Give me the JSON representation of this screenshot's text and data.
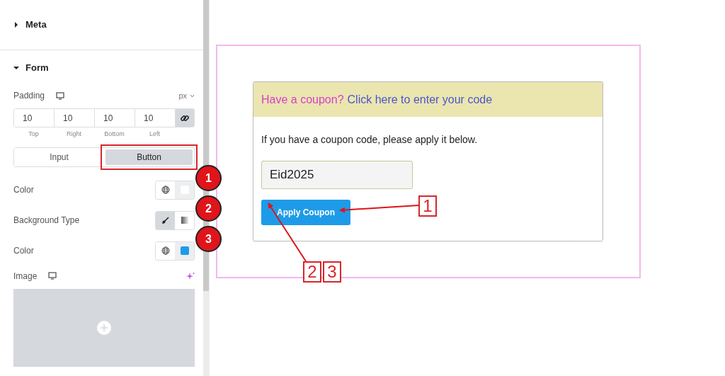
{
  "sidebar": {
    "sections": [
      {
        "title": "Meta",
        "expanded": false
      },
      {
        "title": "Form",
        "expanded": true
      }
    ],
    "padding": {
      "label": "Padding",
      "unit": "px",
      "linked": true,
      "fields": [
        {
          "value": "10",
          "label": "Top"
        },
        {
          "value": "10",
          "label": "Right"
        },
        {
          "value": "10",
          "label": "Bottom"
        },
        {
          "value": "10",
          "label": "Left"
        }
      ]
    },
    "tabs": [
      {
        "label": "Input",
        "selected": false,
        "highlighted": false
      },
      {
        "label": "Button",
        "selected": true,
        "highlighted": true
      }
    ],
    "controls": [
      {
        "kind": "color",
        "label": "Color",
        "color": "#ffffff",
        "callout": "1"
      },
      {
        "kind": "background",
        "label": "Background Type",
        "callout": "2",
        "options": [
          {
            "kind": "classic",
            "selected": true
          },
          {
            "kind": "gradient",
            "selected": false
          }
        ]
      },
      {
        "kind": "color",
        "label": "Color",
        "color": "#1e9be8",
        "callout": "3"
      }
    ],
    "image": {
      "label": "Image"
    }
  },
  "coupon": {
    "notice_prompt": "Have a coupon?",
    "notice_link": "Click here to enter your code",
    "description": "If you have a coupon code, please apply it below.",
    "input_value": "Eid2025",
    "button": "Apply Coupon"
  },
  "annotations": [
    {
      "label": "1",
      "arrow": true
    },
    {
      "label": "2",
      "arrow": true
    },
    {
      "label": "3",
      "arrow": false
    }
  ]
}
